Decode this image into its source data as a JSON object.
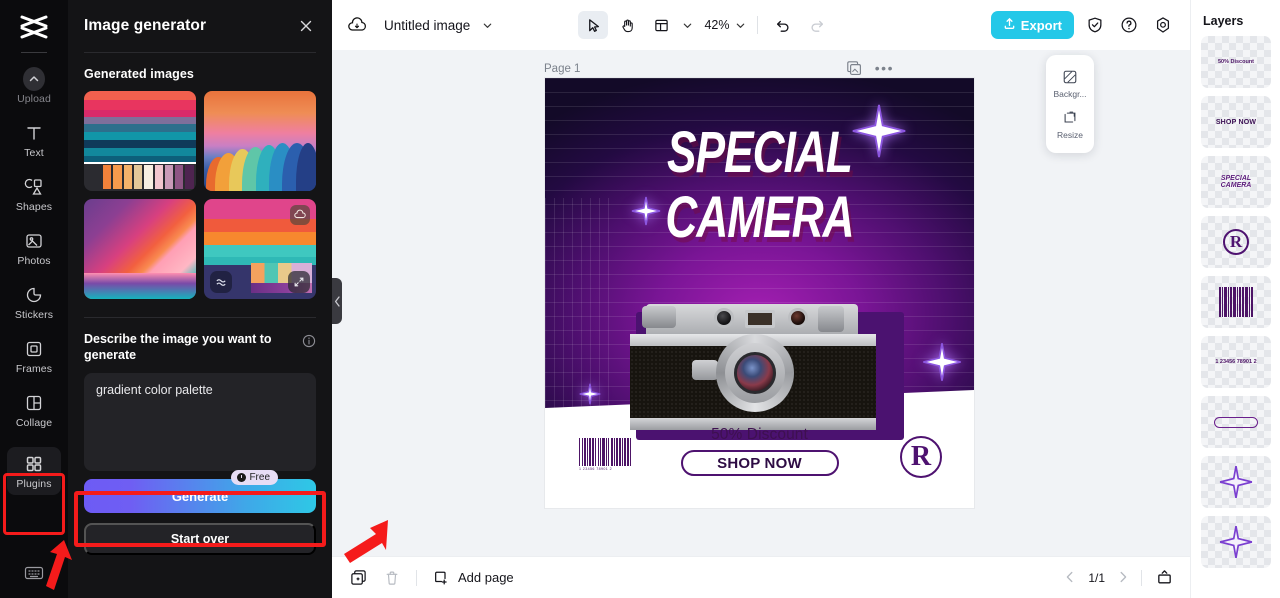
{
  "sidebar": {
    "logo": "capcut-logo",
    "items": [
      {
        "label": "Upload",
        "icon": "upload-chevron-icon"
      },
      {
        "label": "Text",
        "icon": "text-t-icon"
      },
      {
        "label": "Shapes",
        "icon": "shapes-icon"
      },
      {
        "label": "Photos",
        "icon": "photos-image-icon"
      },
      {
        "label": "Stickers",
        "icon": "stickers-icon"
      },
      {
        "label": "Frames",
        "icon": "frames-icon"
      },
      {
        "label": "Collage",
        "icon": "collage-grid-icon"
      },
      {
        "label": "Plugins",
        "icon": "plugins-grid-icon"
      }
    ],
    "bottom_icon": "keyboard-shortcuts-icon"
  },
  "panel": {
    "title": "Image generator",
    "close_icon": "close-icon",
    "section_title": "Generated images",
    "thumbnails": [
      {
        "name": "generated-image-1",
        "alt": "striped gradient palette"
      },
      {
        "name": "generated-image-2",
        "alt": "sunset wave gradient"
      },
      {
        "name": "generated-image-3",
        "alt": "diagonal pink orange gradient"
      },
      {
        "name": "generated-image-4",
        "alt": "blocky color palette",
        "badge": "cloud-download-icon",
        "ctl_left": "effects-icon",
        "ctl_right": "expand-icon"
      }
    ],
    "describe_label": "Describe the image you want to generate",
    "info_icon": "info-icon",
    "prompt_value": "gradient color palette",
    "prompt_placeholder": "gradient color palette",
    "generate_label": "Generate",
    "free_badge": "Free",
    "start_over_label": "Start over"
  },
  "topbar": {
    "cloud_icon": "cloud-save-icon",
    "doc_title": "Untitled image",
    "title_chevron": "chevron-down-icon",
    "tools": [
      {
        "name": "select-tool",
        "icon": "cursor-arrow-icon",
        "selected": true
      },
      {
        "name": "hand-tool",
        "icon": "hand-icon",
        "selected": false
      },
      {
        "name": "layout-tool",
        "icon": "layout-icon",
        "selected": false
      }
    ],
    "layout_chevron": "chevron-down-icon",
    "zoom_level": "42%",
    "zoom_chevron": "chevron-down-icon",
    "undo_icon": "undo-icon",
    "redo_icon": "redo-icon",
    "export_label": "Export",
    "export_icon": "export-upload-icon",
    "shield_icon": "shield-check-icon",
    "help_icon": "help-question-icon",
    "settings_icon": "settings-gear-icon"
  },
  "canvas": {
    "page_label": "Page 1",
    "duplicate_icon": "duplicate-page-icon",
    "more_icon": "more-options-icon",
    "mini_toolbar": [
      {
        "label": "Backgr...",
        "icon": "background-icon"
      },
      {
        "label": "Resize",
        "icon": "resize-icon"
      }
    ],
    "poster": {
      "headline_line1": "SPECIAL",
      "headline_line2": "CAMERA",
      "discount_text": "50% Discount",
      "shop_button": "SHOP NOW",
      "barcode_number": "1  23456 78901   2",
      "registered_mark": "R"
    }
  },
  "bottombar": {
    "duplicate_icon": "duplicate-icon",
    "delete_icon": "trash-icon",
    "add_page_icon": "add-page-icon",
    "add_page_label": "Add page",
    "prev_icon": "chevron-left-icon",
    "page_indicator": "1/1",
    "next_icon": "chevron-right-icon",
    "present_icon": "present-icon"
  },
  "layers": {
    "title": "Layers",
    "items": [
      {
        "name": "layer-discount-text",
        "kind": "text",
        "preview": "50% Discount"
      },
      {
        "name": "layer-shop-now-text",
        "kind": "shop",
        "preview": "SHOP NOW"
      },
      {
        "name": "layer-headline-text",
        "kind": "headline",
        "preview_1": "SPECIAL",
        "preview_2": "CAMERA"
      },
      {
        "name": "layer-registered-mark",
        "kind": "rmark",
        "preview": "R"
      },
      {
        "name": "layer-barcode",
        "kind": "barcode",
        "preview": ""
      },
      {
        "name": "layer-barcode-number",
        "kind": "text",
        "preview": "1 23456 78901 2"
      },
      {
        "name": "layer-pill-shape",
        "kind": "pill",
        "preview": ""
      },
      {
        "name": "layer-star-1",
        "kind": "star",
        "preview": ""
      },
      {
        "name": "layer-star-2",
        "kind": "star",
        "preview": ""
      }
    ]
  },
  "annotations": {
    "highlight_color": "#f51b1b",
    "boxes": [
      "plugins-sidebar-item",
      "generate-button"
    ],
    "arrows": [
      "arrow-to-plugins",
      "arrow-to-generate"
    ]
  },
  "colors": {
    "accent": "#24c8e8",
    "generate_gradient_start": "#6d5bf5",
    "generate_gradient_end": "#2ec8e6",
    "panel_bg": "#141416",
    "rail_bg": "#0b0b0d",
    "canvas_bg": "#f1f3f6",
    "poster_purple": "#4d1466"
  }
}
